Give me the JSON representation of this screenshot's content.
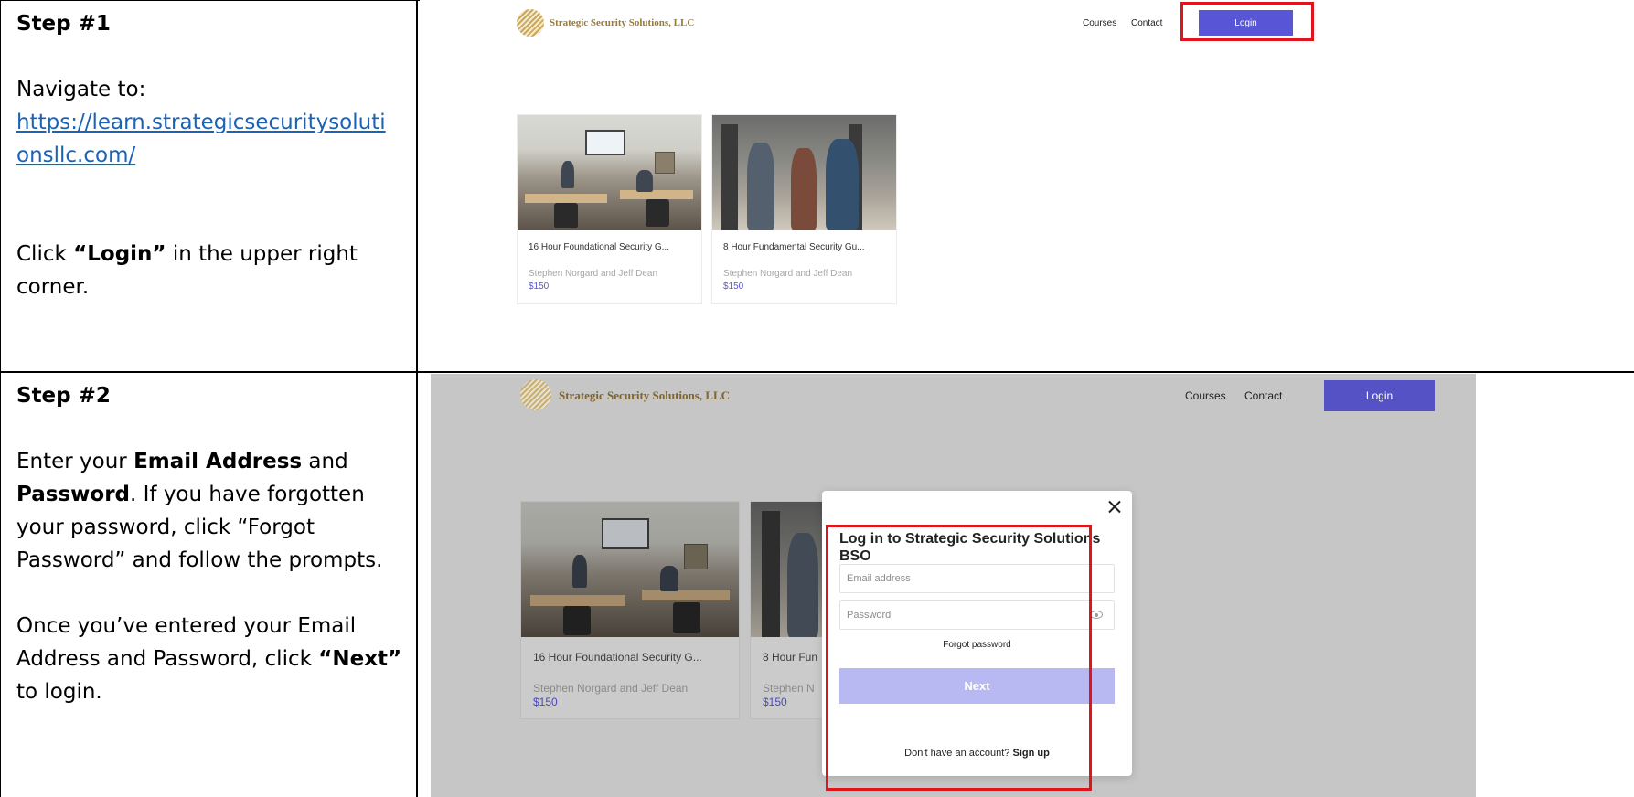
{
  "step1": {
    "title": "Step #1",
    "navigate_label": "Navigate to:",
    "url": "https://learn.strategicsecuritysolutionsllc.com/",
    "url_line1": "https://learn.strategicsecuritysoluti",
    "url_line2": "onsllc.com/",
    "instruction_prefix": "Click ",
    "instruction_bold": "“Login”",
    "instruction_suffix": " in the upper right corner."
  },
  "step2": {
    "title": "Step #2",
    "para1_prefix": "Enter your ",
    "para1_bold1": "Email Address",
    "para1_mid": " and ",
    "para1_bold2": "Password",
    "para1_suffix": ". If you have forgotten your password, click “Forgot Password” and follow the prompts.",
    "para2_prefix": "Once you’ve entered your Email Address and Password, click ",
    "para2_bold": "“Next”",
    "para2_suffix": " to login."
  },
  "site": {
    "brand": "Strategic Security Solutions, LLC",
    "nav": {
      "courses": "Courses",
      "contact": "Contact",
      "login": "Login"
    },
    "courses": [
      {
        "title": "16 Hour Foundational Security G...",
        "author": "Stephen Norgard and Jeff Dean",
        "price": "$150"
      },
      {
        "title": "8 Hour Fundamental Security Gu...",
        "author": "Stephen Norgard and Jeff Dean",
        "price": "$150"
      }
    ],
    "courses_partial": [
      {
        "title": "8 Hour Fun",
        "author": "Stephen N",
        "price": "$150"
      }
    ]
  },
  "modal": {
    "title": "Log in to Strategic Security Solutions BSO",
    "email_placeholder": "Email address",
    "password_placeholder": "Password",
    "forgot": "Forgot password",
    "next": "Next",
    "no_account": "Don't have an account?",
    "signup": "Sign up"
  },
  "colors": {
    "accent": "#5856d6",
    "highlight": "#e0151b",
    "link": "#1a63b7"
  },
  "icons": [
    "logo-mark-icon",
    "close-icon",
    "eye-icon"
  ]
}
